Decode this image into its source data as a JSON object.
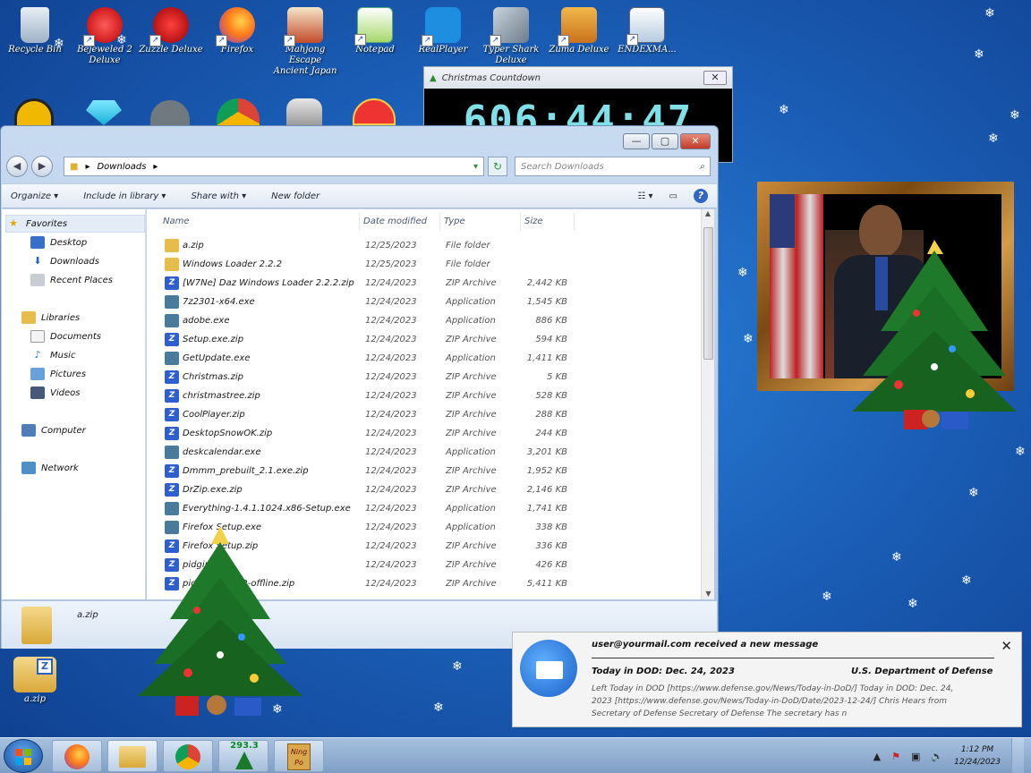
{
  "desktop_icons": [
    {
      "label": "Recycle Bin"
    },
    {
      "label": "Bejeweled 2 Deluxe"
    },
    {
      "label": "Zuzzle Deluxe"
    },
    {
      "label": "Firefox"
    },
    {
      "label": "Mahjong Escape Ancient Japan"
    },
    {
      "label": "Notepad"
    },
    {
      "label": "RealPlayer"
    },
    {
      "label": "Typer Shark Deluxe"
    },
    {
      "label": "Zuma Deluxe"
    },
    {
      "label": "ENDEXMA..."
    }
  ],
  "bottom_desktop_icon": {
    "label": "a.zip"
  },
  "countdown": {
    "title": "Christmas Countdown",
    "time": "606:44:47",
    "close": "✕"
  },
  "explorer": {
    "address_path": "Downloads",
    "search_placeholder": "Search Downloads",
    "toolbar": {
      "organize": "Organize",
      "include": "Include in library",
      "share": "Share with",
      "new_folder": "New folder"
    },
    "nav": {
      "favorites": "Favorites",
      "desktop": "Desktop",
      "downloads": "Downloads",
      "recent": "Recent Places",
      "libraries": "Libraries",
      "documents": "Documents",
      "music": "Music",
      "pictures": "Pictures",
      "videos": "Videos",
      "computer": "Computer",
      "network": "Network"
    },
    "columns": {
      "name": "Name",
      "date": "Date modified",
      "type": "Type",
      "size": "Size"
    },
    "files": [
      {
        "name": "a.zip",
        "date": "12/25/2023",
        "type": "File folder",
        "size": ""
      },
      {
        "name": "Windows Loader 2.2.2",
        "date": "12/25/2023",
        "type": "File folder",
        "size": ""
      },
      {
        "name": "[W7Ne] Daz Windows Loader 2.2.2.zip",
        "date": "12/24/2023",
        "type": "ZIP Archive",
        "size": "2,442 KB"
      },
      {
        "name": "7z2301-x64.exe",
        "date": "12/24/2023",
        "type": "Application",
        "size": "1,545 KB"
      },
      {
        "name": "adobe.exe",
        "date": "12/24/2023",
        "type": "Application",
        "size": "886 KB"
      },
      {
        "name": "Setup.exe.zip",
        "date": "12/24/2023",
        "type": "ZIP Archive",
        "size": "594 KB"
      },
      {
        "name": "GetUpdate.exe",
        "date": "12/24/2023",
        "type": "Application",
        "size": "1,411 KB"
      },
      {
        "name": "Christmas.zip",
        "date": "12/24/2023",
        "type": "ZIP Archive",
        "size": "5 KB"
      },
      {
        "name": "christmastree.zip",
        "date": "12/24/2023",
        "type": "ZIP Archive",
        "size": "528 KB"
      },
      {
        "name": "CoolPlayer.zip",
        "date": "12/24/2023",
        "type": "ZIP Archive",
        "size": "288 KB"
      },
      {
        "name": "DesktopSnowOK.zip",
        "date": "12/24/2023",
        "type": "ZIP Archive",
        "size": "244 KB"
      },
      {
        "name": "deskcalendar.exe",
        "date": "12/24/2023",
        "type": "Application",
        "size": "3,201 KB"
      },
      {
        "name": "Dmmm_prebuilt_2.1.exe.zip",
        "date": "12/24/2023",
        "type": "ZIP Archive",
        "size": "1,952 KB"
      },
      {
        "name": "DrZip.exe.zip",
        "date": "12/24/2023",
        "type": "ZIP Archive",
        "size": "2,146 KB"
      },
      {
        "name": "Everything-1.4.1.1024.x86-Setup.exe",
        "date": "12/24/2023",
        "type": "Application",
        "size": "1,741 KB"
      },
      {
        "name": "Firefox Setup.exe",
        "date": "12/24/2023",
        "type": "Application",
        "size": "338 KB"
      },
      {
        "name": "Firefox Setup.zip",
        "date": "12/24/2023",
        "type": "ZIP Archive",
        "size": "336 KB"
      },
      {
        "name": "pidgin.zip",
        "date": "12/24/2023",
        "type": "ZIP Archive",
        "size": "426 KB"
      },
      {
        "name": "pidgin-2.14.12-offline.zip",
        "date": "12/24/2023",
        "type": "ZIP Archive",
        "size": "5,411 KB"
      }
    ],
    "details_label": "a.zip"
  },
  "notification": {
    "title": "user@yourmail.com received a new message",
    "subject": "Today in DOD: Dec. 24, 2023",
    "sender": "U.S. Department of Defense",
    "body": "Left Today in DOD [https://www.defense.gov/News/Today-in-DoD/] Today in DOD: Dec. 24, 2023 [https://www.defense.gov/News/Today-in-DoD/Date/2023-12-24/] Chris Hears from Secretary of Defense Secretary of Defense The secretary has n",
    "close": "✕"
  },
  "taskbar": {
    "tree_counter": "293.3",
    "notepad_label": "Ning Po"
  },
  "tray": {
    "time": "1:12 PM",
    "date": "12/24/2023"
  },
  "colors": {
    "accent": "#1b5fb8",
    "window_frame": "#aec6e6",
    "taskbar": "#8fadd2"
  }
}
